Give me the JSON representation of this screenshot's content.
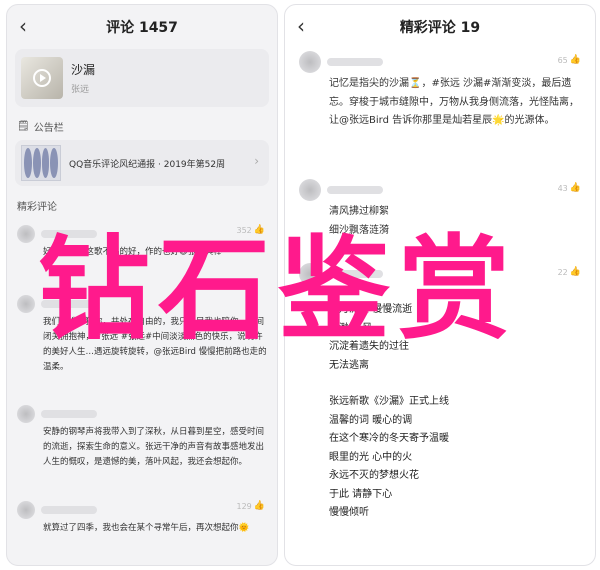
{
  "left": {
    "title": "评论 1457",
    "song": {
      "name": "沙漏",
      "artist": "张远"
    },
    "notice_label": "公告栏",
    "notice_text": "QQ音乐评论风纪通报 · 2019年第52周",
    "section": "精彩评论",
    "comments": [
      {
        "likes": "352",
        "text": "好好听啊！这歌不唱的好，作的也好😆张远真棒"
      },
      {
        "likes": "",
        "text": "我们要选择独你，共处在自由的，我只陪目我也陪你，人间闭关拥抱神，#张远 #张远#中间淡淡黑色的快乐，说明许的美好人生…遇远旋转旋转，@张远Bird 慢慢把前路也走的温柔。"
      },
      {
        "likes": "",
        "text": "安静的钢琴声将我带入到了深秋，从日暮到星空，感受时间的流逝，探索生命的意义。张远干净的声音有故事感地发出人生的慨叹，是遗憾的美，落叶风起，我还会想起你。"
      },
      {
        "likes": "129",
        "text": "就算过了四季，我也会在某个寻常午后，再次想起你🌞"
      }
    ]
  },
  "right": {
    "title": "精彩评论 19",
    "comments": [
      {
        "likes": "65",
        "text": "记忆是指尖的沙漏⏳，#张远 沙漏#渐渐变淡，最后遗忘。穿梭于城市缝隙中，万物从我身侧流落，光怪陆离，让@张远Bird 告诉你那里是灿若星辰🌟的光源体。"
      },
      {
        "likes": "43",
        "text": "清风拂过柳絮\n细沙飘落涟漪"
      },
      {
        "likes": "22",
        "text": ""
      }
    ],
    "lyrics": [
      "岁月流过 慢慢流逝",
      "飘渺的 风",
      "沉淀着遗失的过往",
      "无法逃离",
      "",
      "张远新歌《沙漏》正式上线",
      "温馨的词 暖心的调",
      "在这个寒冷的冬天寄予温暖",
      "眼里的光 心中的火",
      "永远不灭的梦想火花",
      "于此 请静下心",
      "慢慢倾听"
    ]
  },
  "overlay_text": "钻石鉴赏",
  "colors": {
    "accent": "#ff1a8c"
  }
}
